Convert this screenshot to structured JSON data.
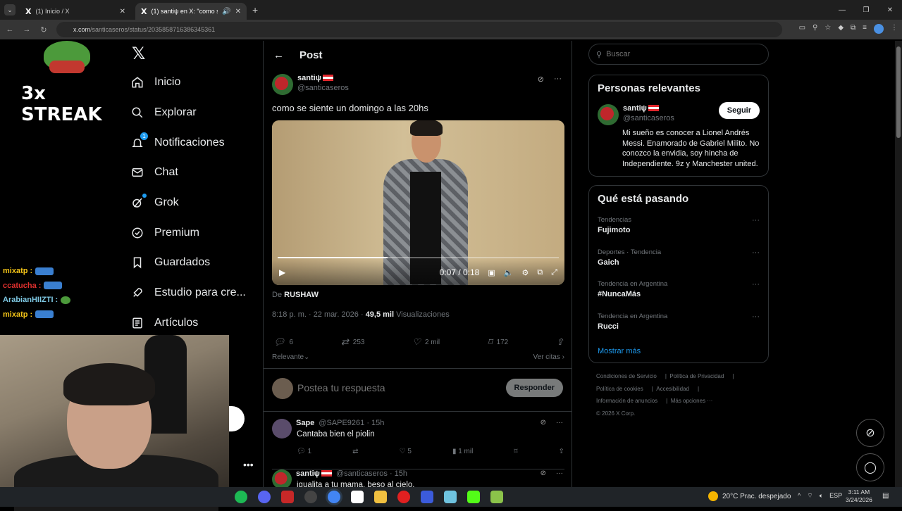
{
  "browser": {
    "tabs": [
      {
        "title": "(1) Inicio / X",
        "active": false
      },
      {
        "title": "(1) santiψ en X: \"como se",
        "active": true
      }
    ],
    "url_host": "x.com",
    "url_path": "/santicaseros/status/2035858716386345361"
  },
  "overlay": {
    "streak_text": "3x STREAK",
    "chat": [
      {
        "user": "mixatp :",
        "color": "#f5c518"
      },
      {
        "user": "ccatucha :",
        "color": "#e0302e"
      },
      {
        "user": "ArabianHIIZTI :",
        "color": "#7ec8e3"
      },
      {
        "user": "mixatp :",
        "color": "#f5c518"
      }
    ]
  },
  "nav": {
    "items": [
      {
        "label": "Inicio",
        "icon": "home-icon"
      },
      {
        "label": "Explorar",
        "icon": "search-icon"
      },
      {
        "label": "Notificaciones",
        "icon": "bell-icon",
        "badge": "1"
      },
      {
        "label": "Chat",
        "icon": "mail-icon"
      },
      {
        "label": "Grok",
        "icon": "grok-icon"
      },
      {
        "label": "Premium",
        "icon": "verified-icon"
      },
      {
        "label": "Guardados",
        "icon": "bookmark-icon"
      },
      {
        "label": "Estudio para cre...",
        "icon": "rocket-icon"
      },
      {
        "label": "Artículos",
        "icon": "article-icon"
      }
    ]
  },
  "post": {
    "header_title": "Post",
    "author_name": "santiψ",
    "author_handle": "@santicaseros",
    "text": "como se siente un domingo a las 20hs",
    "video_time": "0:07 / 0:18",
    "video_progress": 0.39,
    "from_prefix": "De",
    "from_source": "RUSHAW",
    "meta_time": "8:18 p. m. · 22 mar. 2026 ·",
    "views_count": "49,5 mil",
    "views_label": "Visualizaciones",
    "replies": "6",
    "reposts": "253",
    "likes": "2 mil",
    "bookmarks": "172",
    "sort_label": "Relevante",
    "quotes_label": "Ver citas"
  },
  "reply_box": {
    "placeholder": "Postea tu respuesta",
    "button": "Responder"
  },
  "replies": [
    {
      "name": "Sape",
      "handle": "@SAPE9261 · 15h",
      "text": "Cantaba bien el piolin",
      "replies": "1",
      "likes": "5",
      "views": "1 mil"
    },
    {
      "name": "santiψ",
      "handle": "@santicaseros · 15h",
      "text": "igualita a tu mama, beso al cielo."
    }
  ],
  "sidebar": {
    "search_placeholder": "Buscar",
    "people_title": "Personas relevantes",
    "person_name": "santiψ",
    "person_handle": "@santicaseros",
    "follow_label": "Seguir",
    "person_bio": "Mi sueño es conocer a Lionel Andrés Messi. Enamorado de Gabriel Milito. No conozco la envidia, soy hincha de Independiente. 9z y Manchester united.",
    "trends_title": "Qué está pasando",
    "trends": [
      {
        "context": "Tendencias",
        "topic": "Fujimoto"
      },
      {
        "context": "Deportes · Tendencia",
        "topic": "Gaich"
      },
      {
        "context": "Tendencia en Argentina",
        "topic": "#NuncaMás"
      },
      {
        "context": "Tendencia en Argentina",
        "topic": "Rucci"
      }
    ],
    "show_more": "Mostrar más",
    "footer": {
      "terms": "Condiciones de Servicio",
      "privacy": "Política de Privacidad",
      "cookies": "Política de cookies",
      "accessibility": "Accesibilidad",
      "ads": "Información de anuncios",
      "more": "Más opciones ···",
      "copyright": "© 2026 X Corp."
    }
  },
  "taskbar": {
    "weather": "20°C  Prac. despejado",
    "lang": "ESP",
    "time": "3:11 AM",
    "date": "3/24/2026"
  }
}
